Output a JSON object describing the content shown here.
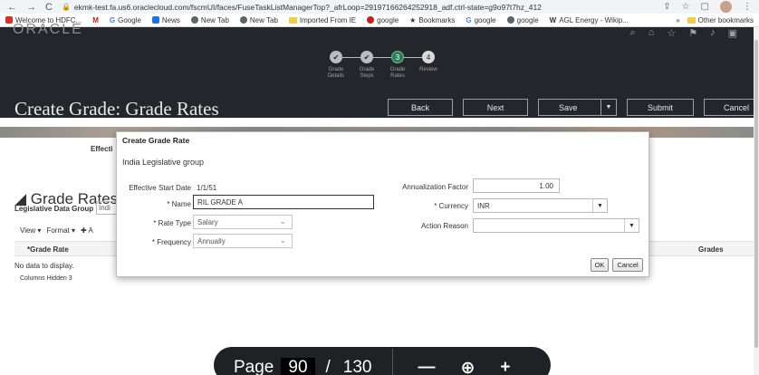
{
  "browser": {
    "back": "←",
    "forward": "→",
    "reload": "C",
    "url": "ekmk-test.fa.us6.oraclecloud.com/fscmUI/faces/FuseTaskListManagerTop?_afrLoop=29197166264252918_adf.ctrl-state=g9o97t7hz_412",
    "bookmarks": [
      {
        "label": "Welcome to HDFC...",
        "color": "#d93025"
      },
      {
        "label": "",
        "color": "#c5221f",
        "glyph": "M"
      },
      {
        "label": "Google",
        "color": "#4285f4",
        "glyph": "G"
      },
      {
        "label": "News",
        "color": "#1a73e8"
      },
      {
        "label": "New Tab",
        "color": "#5f6368"
      },
      {
        "label": "New Tab",
        "color": "#5f6368"
      },
      {
        "label": "Imported From IE",
        "color": "#f7c948"
      },
      {
        "label": "google",
        "color": "#c5221f"
      },
      {
        "label": "Bookmarks",
        "color": "#333333",
        "glyph": "★"
      },
      {
        "label": "google",
        "color": "#4285f4",
        "glyph": "G"
      },
      {
        "label": "google",
        "color": "#5f6368"
      },
      {
        "label": "AGL Energy - Wikip...",
        "color": "#333333",
        "glyph": "W"
      }
    ],
    "bookmarks_more": "»",
    "other_bookmarks": "Other bookmarks"
  },
  "app": {
    "brand": "ORACLE",
    "page_title": "Create Grade: Grade Rates",
    "train": [
      {
        "label": "Grade\nDetails",
        "state": "done",
        "mark": "✔"
      },
      {
        "label": "Grade\nSteps",
        "state": "done",
        "mark": "✔"
      },
      {
        "label": "Grade\nRates",
        "state": "active",
        "mark": "3"
      },
      {
        "label": "Review",
        "state": "todo",
        "mark": "4"
      }
    ],
    "buttons": {
      "back": "Back",
      "next": "Next",
      "save": "Save",
      "submit": "Submit",
      "cancel": "Cancel"
    }
  },
  "background": {
    "effective_label": "Effecti",
    "section_title": "Grade Rates",
    "legislative_group_label": "Legislative Data Group",
    "legislative_group_value": "Indi",
    "view_menu": "View ▾",
    "format_menu": "Format ▾",
    "add": "✚ A",
    "col_grade_rate": "*Grade Rate",
    "col_grades": "Grades",
    "no_data": "No data to display.",
    "columns_hidden": "Columns Hidden  3"
  },
  "modal": {
    "title": "Create Grade Rate",
    "subtitle": "India Legislative group",
    "effective_start_date_label": "Effective Start Date",
    "effective_start_date": "1/1/51",
    "name_label": "Name",
    "name_value": "RIL GRADE A",
    "rate_type_label": "Rate Type",
    "rate_type_value": "Salary",
    "frequency_label": "Frequency",
    "frequency_value": "Annually",
    "annualization_label": "Annualization Factor",
    "annualization_value": "1.00",
    "currency_label": "Currency",
    "currency_value": "INR",
    "action_reason_label": "Action Reason",
    "action_reason_value": "",
    "ok": "OK",
    "cancel": "Cancel"
  },
  "pdf_viewer": {
    "page_label": "Page",
    "page_number": "90",
    "slash": "/",
    "total_pages": "130",
    "zoom_out": "—",
    "zoom_in": "+"
  }
}
